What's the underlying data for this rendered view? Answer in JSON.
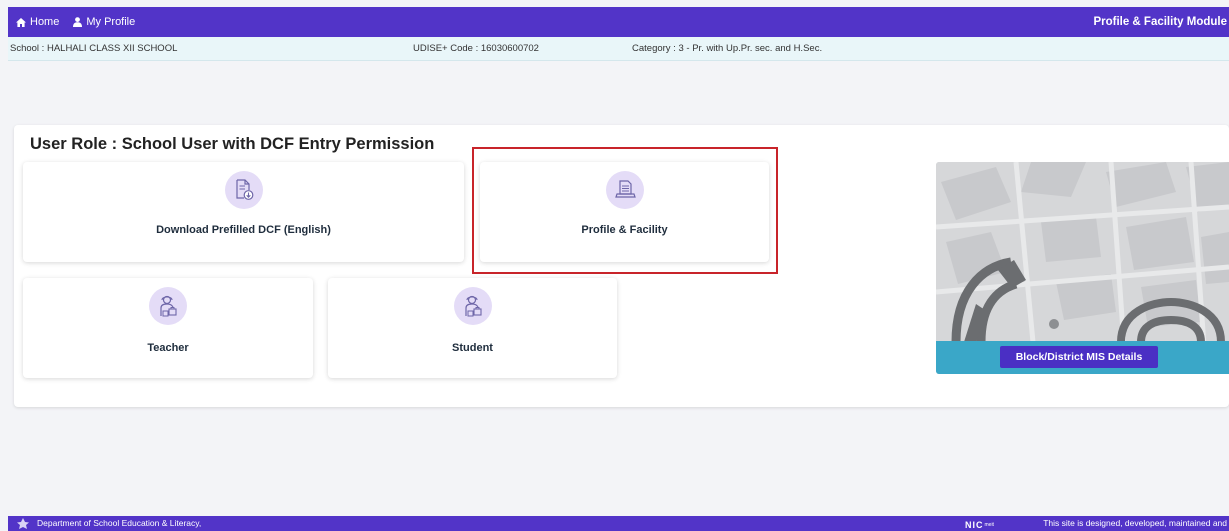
{
  "topbar": {
    "nav": {
      "home": "Home",
      "my_profile": "My Profile"
    },
    "module_title": "Profile & Facility Module",
    "color": "#5234c8"
  },
  "info": {
    "school": "School : HALHALI CLASS XII SCHOOL",
    "udise": "UDISE+ Code : 16030600702",
    "category": "Category : 3 - Pr. with Up.Pr. sec. and H.Sec."
  },
  "main": {
    "role_title": "User Role : School User with DCF Entry Permission",
    "cards": [
      {
        "label": "Download Prefilled DCF (English)",
        "icon": "document-download-icon"
      },
      {
        "label": "Profile & Facility",
        "icon": "computer-document-icon",
        "highlighted": true
      },
      {
        "label": "Teacher",
        "icon": "user-bags-icon"
      },
      {
        "label": "Student",
        "icon": "user-bags-icon"
      }
    ],
    "side": {
      "button_label": "Block/District MIS Details"
    }
  },
  "footer": {
    "dept": "Department of School Education & Literacy,",
    "nic": "NIC",
    "nic_small": "meit",
    "designed": "This site is designed, developed, maintained and"
  },
  "colors": {
    "accent": "#5234c8",
    "highlight": "#c8242a",
    "strip": "#3aa7c8",
    "icon_bg": "#e4dcf7"
  }
}
